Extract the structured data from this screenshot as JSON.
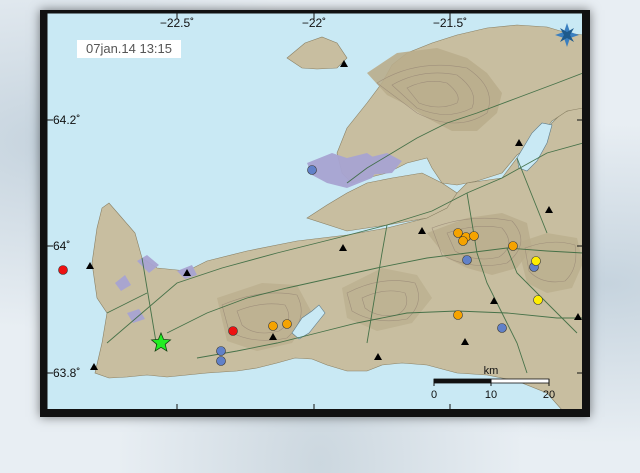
{
  "map": {
    "timestamp": "07jan.14  13:15",
    "lon_labels": [
      "−22.5˚",
      "−22˚",
      "−21.5˚"
    ],
    "lat_labels": [
      "64.2˚",
      "64˚",
      "63.8˚"
    ],
    "scale": {
      "unit": "km",
      "ticks": [
        "0",
        "10",
        "20"
      ]
    },
    "colors": {
      "sea": "#c9e9f4",
      "land": "#c8bea0",
      "mountain": "#b9ad8c",
      "lava": "#a8a4d2",
      "roads": "#3a6a40",
      "contours": "#9a8a78",
      "eq_red": "#ee1111",
      "eq_orange": "#f5a300",
      "eq_yellow": "#ffee00",
      "eq_blue": "#6181c8",
      "star": "#22ee22"
    },
    "icons": {
      "compass": "compass-rose-icon",
      "station": "triangle-station-icon",
      "largest_quake": "star-icon"
    }
  },
  "earthquakes": [
    {
      "color": "red"
    },
    {
      "color": "red"
    },
    {
      "color": "blue"
    },
    {
      "color": "blue"
    },
    {
      "color": "blue"
    },
    {
      "color": "blue"
    },
    {
      "color": "blue"
    },
    {
      "color": "blue"
    },
    {
      "color": "orange"
    },
    {
      "color": "orange"
    },
    {
      "color": "orange"
    },
    {
      "color": "orange"
    },
    {
      "color": "orange"
    },
    {
      "color": "orange"
    },
    {
      "color": "orange"
    },
    {
      "color": "orange"
    },
    {
      "color": "yellow"
    },
    {
      "color": "yellow"
    }
  ],
  "largest": {
    "symbol": "star"
  }
}
